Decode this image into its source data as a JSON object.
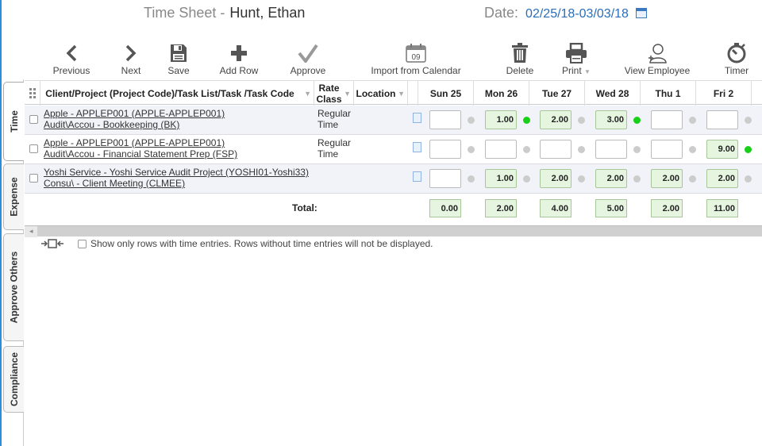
{
  "header": {
    "title": "Time Sheet -",
    "employee": "Hunt, Ethan",
    "date_label": "Date:",
    "date_range": "02/25/18-03/03/18"
  },
  "toolbar": {
    "previous": "Previous",
    "next": "Next",
    "save": "Save",
    "add_row": "Add Row",
    "approve": "Approve",
    "import_calendar": "Import from Calendar",
    "calendar_icon_day": "09",
    "delete": "Delete",
    "print": "Print",
    "print_caret": "▼",
    "view_employee": "View Employee",
    "timer": "Timer"
  },
  "side_tabs": [
    "Time",
    "Expense",
    "Approve Others",
    "Compliance"
  ],
  "columns": {
    "task": "Client/Project (Project Code)/Task List/Task /Task Code",
    "rate": "Rate Class",
    "location": "Location",
    "days": [
      "Sun 25",
      "Mon 26",
      "Tue 27",
      "Wed 28",
      "Thu 1",
      "Fri 2"
    ]
  },
  "rows": [
    {
      "line1": "Apple - APPLEP001 (APPLE-APPLEP001)",
      "line2": "Audit\\Accou - Bookkeeping (BK)",
      "rate1": "Regular",
      "rate2": "Time",
      "hours": [
        "",
        "1.00",
        "2.00",
        "3.00",
        "",
        ""
      ],
      "status": [
        "grey",
        "green",
        "grey",
        "green",
        "grey",
        "grey"
      ]
    },
    {
      "line1": "Apple - APPLEP001 (APPLE-APPLEP001)",
      "line2": "Audit\\Accou - Financial Statement Prep (FSP)",
      "rate1": "Regular",
      "rate2": "Time",
      "hours": [
        "",
        "",
        "",
        "",
        "",
        "9.00"
      ],
      "status": [
        "grey",
        "grey",
        "grey",
        "grey",
        "grey",
        "green"
      ]
    },
    {
      "line1": "Yoshi Service - Yoshi Service Audit Project (YOSHI01-Yoshi33)",
      "line2": "Consu\\ - Client Meeting (CLMEE)",
      "rate1": "",
      "rate2": "",
      "hours": [
        "",
        "1.00",
        "2.00",
        "2.00",
        "2.00",
        "2.00"
      ],
      "status": [
        "grey",
        "grey",
        "grey",
        "grey",
        "grey",
        "grey"
      ]
    }
  ],
  "totals": {
    "label": "Total:",
    "values": [
      "0.00",
      "2.00",
      "4.00",
      "5.00",
      "2.00",
      "11.00"
    ]
  },
  "footer": {
    "show_only_label": "Show only rows with time entries. Rows without time entries will not be displayed."
  },
  "colors": {
    "accent": "#2a6ebb",
    "filled_cell": "#e6f5e0",
    "status_green": "#19d019",
    "status_grey": "#cccccc",
    "row_alt": "#f1f3f9"
  }
}
